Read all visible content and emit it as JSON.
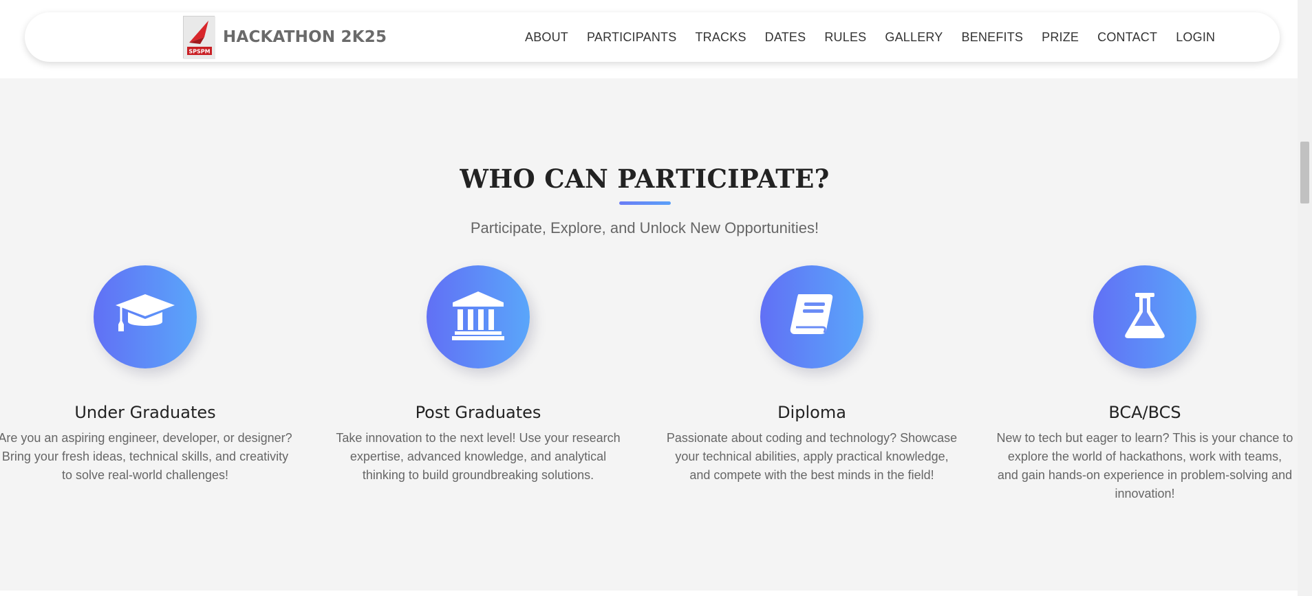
{
  "brand": {
    "name": "HACKATHON 2K25",
    "logo_text": "SPSPM"
  },
  "nav": {
    "items": [
      "ABOUT",
      "PARTICIPANTS",
      "TRACKS",
      "DATES",
      "RULES",
      "GALLERY",
      "BENEFITS",
      "PRIZE",
      "CONTACT",
      "LOGIN"
    ]
  },
  "section": {
    "title": "WHO CAN PARTICIPATE?",
    "subtitle": "Participate, Explore, and Unlock New Opportunities!",
    "accent_colors": [
      "#6170f5",
      "#5aa6fa"
    ],
    "cards": [
      {
        "icon": "graduation-cap-icon",
        "title": "Under Graduates",
        "desc": "Are you an aspiring engineer, developer, or designer? Bring your fresh ideas, technical skills, and creativity to solve real-world challenges!"
      },
      {
        "icon": "university-icon",
        "title": "Post Graduates",
        "desc": "Take innovation to the next level! Use your research expertise, advanced knowledge, and analytical thinking to build groundbreaking solutions."
      },
      {
        "icon": "book-icon",
        "title": "Diploma",
        "desc": "Passionate about coding and technology? Showcase your technical abilities, apply practical knowledge, and compete with the best minds in the field!"
      },
      {
        "icon": "flask-icon",
        "title": "BCA/BCS",
        "desc": "New to tech but eager to learn? This is your chance to explore the world of hackathons, work with teams, and gain hands-on experience in problem-solving and innovation!"
      }
    ]
  }
}
